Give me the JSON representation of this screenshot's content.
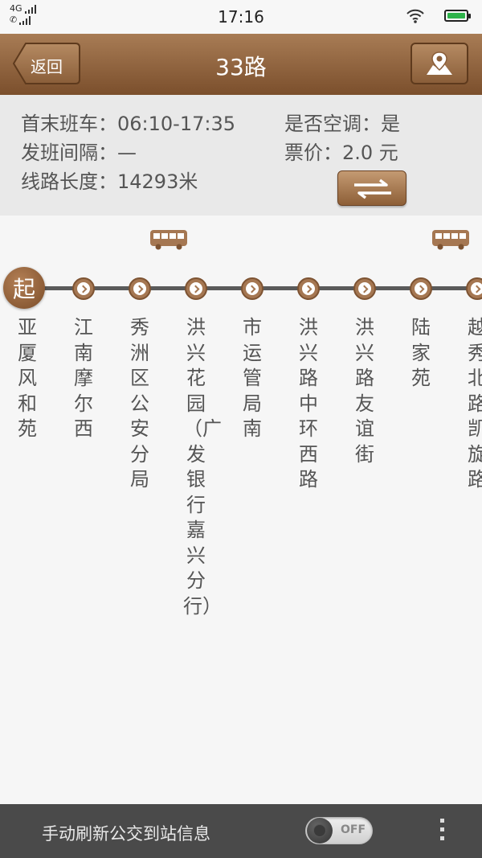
{
  "status_bar": {
    "network": "4G",
    "time": "17:16"
  },
  "header": {
    "back_label": "返回",
    "title": "33路"
  },
  "info": {
    "first_last_bus": "首末班车：06:10-17:35",
    "interval": "发班间隔：—",
    "length": "线路长度：14293米",
    "air_conditioning": "是否空调：是",
    "fare": "票价：2.0 元"
  },
  "route": {
    "start_label": "起",
    "stops": [
      {
        "name": "亚厦风和苑"
      },
      {
        "name": "江南摩尔西"
      },
      {
        "name": "秀洲区公安分局"
      },
      {
        "name": "洪兴花园（广发银行嘉兴分行）"
      },
      {
        "name": "市运管局南"
      },
      {
        "name": "洪兴路中环西路"
      },
      {
        "name": "洪兴路友谊街"
      },
      {
        "name": "陆家苑"
      },
      {
        "name": "越秀北路凯旋路"
      }
    ]
  },
  "bottom": {
    "refresh_label": "手动刷新公交到站信息",
    "toggle_label": "OFF"
  },
  "colors": {
    "accent_brown": "#8a5e39",
    "track": "#5a5a5a",
    "bottom_bar": "#4a4a4a"
  },
  "icons": {
    "map": "map-pin-icon",
    "swap": "swap-arrows-icon",
    "bus": "bus-icon",
    "more": "more-vertical-icon"
  }
}
